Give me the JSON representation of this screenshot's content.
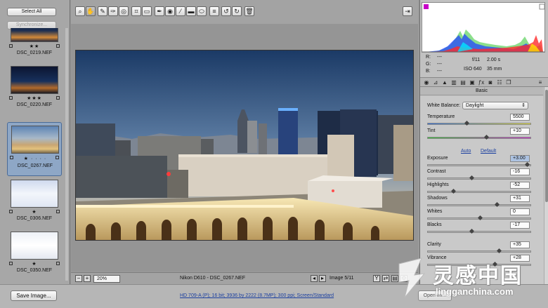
{
  "filmstrip": {
    "select_all": "Select All",
    "synchronize": "Synchronize...",
    "thumbs": [
      {
        "name": "DSC_0219.NEF",
        "stars": "★★"
      },
      {
        "name": "DSC_0220.NEF",
        "stars": "★★★"
      },
      {
        "name": "DSC_0267.NEF",
        "stars": "★ · · · ·"
      },
      {
        "name": "DSC_0306.NEF",
        "stars": "★"
      },
      {
        "name": "DSC_0350.NEF",
        "stars": "★"
      }
    ]
  },
  "status": {
    "zoom": "20%",
    "filename": "Nikon D610  -  DSC_0267.NEF",
    "image_counter": "Image 5/11"
  },
  "histogram": {
    "r_label": "R:",
    "r_value": "---",
    "g_label": "G:",
    "g_value": "---",
    "b_label": "B:",
    "b_value": "---",
    "aperture": "f/11",
    "shutter": "2.00 s",
    "iso": "ISO 640",
    "focal": "35 mm"
  },
  "panel": {
    "title": "Basic",
    "white_balance_label": "White Balance:",
    "white_balance_value": "Daylight",
    "auto": "Auto",
    "default": "Default",
    "sliders": [
      {
        "label": "Temperature",
        "value": "5500",
        "pos": 0.37
      },
      {
        "label": "Tint",
        "value": "+10",
        "pos": 0.56
      },
      {
        "label": "Exposure",
        "value": "+3.00",
        "pos": 0.95
      },
      {
        "label": "Contrast",
        "value": "-16",
        "pos": 0.42
      },
      {
        "label": "Highlights",
        "value": "-52",
        "pos": 0.24
      },
      {
        "label": "Shadows",
        "value": "+31",
        "pos": 0.66
      },
      {
        "label": "Whites",
        "value": "0",
        "pos": 0.5
      },
      {
        "label": "Blacks",
        "value": "-17",
        "pos": 0.42
      },
      {
        "label": "Clarity",
        "value": "+35",
        "pos": 0.68
      },
      {
        "label": "Vibrance",
        "value": "+28",
        "pos": 0.64
      }
    ]
  },
  "bottom": {
    "save_image": "Save Image...",
    "workflow_options": "HD 709-A (P); 16 bit; 3936 by 2222 (8.7MP); 300 ppi; Screen/Standard",
    "open_image": "Open Im..."
  },
  "watermark": {
    "text": "灵感中国",
    "url": "lingganchina.com"
  },
  "colors": {
    "accent": "#1a3fa0",
    "selected_thumb": "#8ea7c6",
    "highlight_value": "#adc3e2"
  }
}
